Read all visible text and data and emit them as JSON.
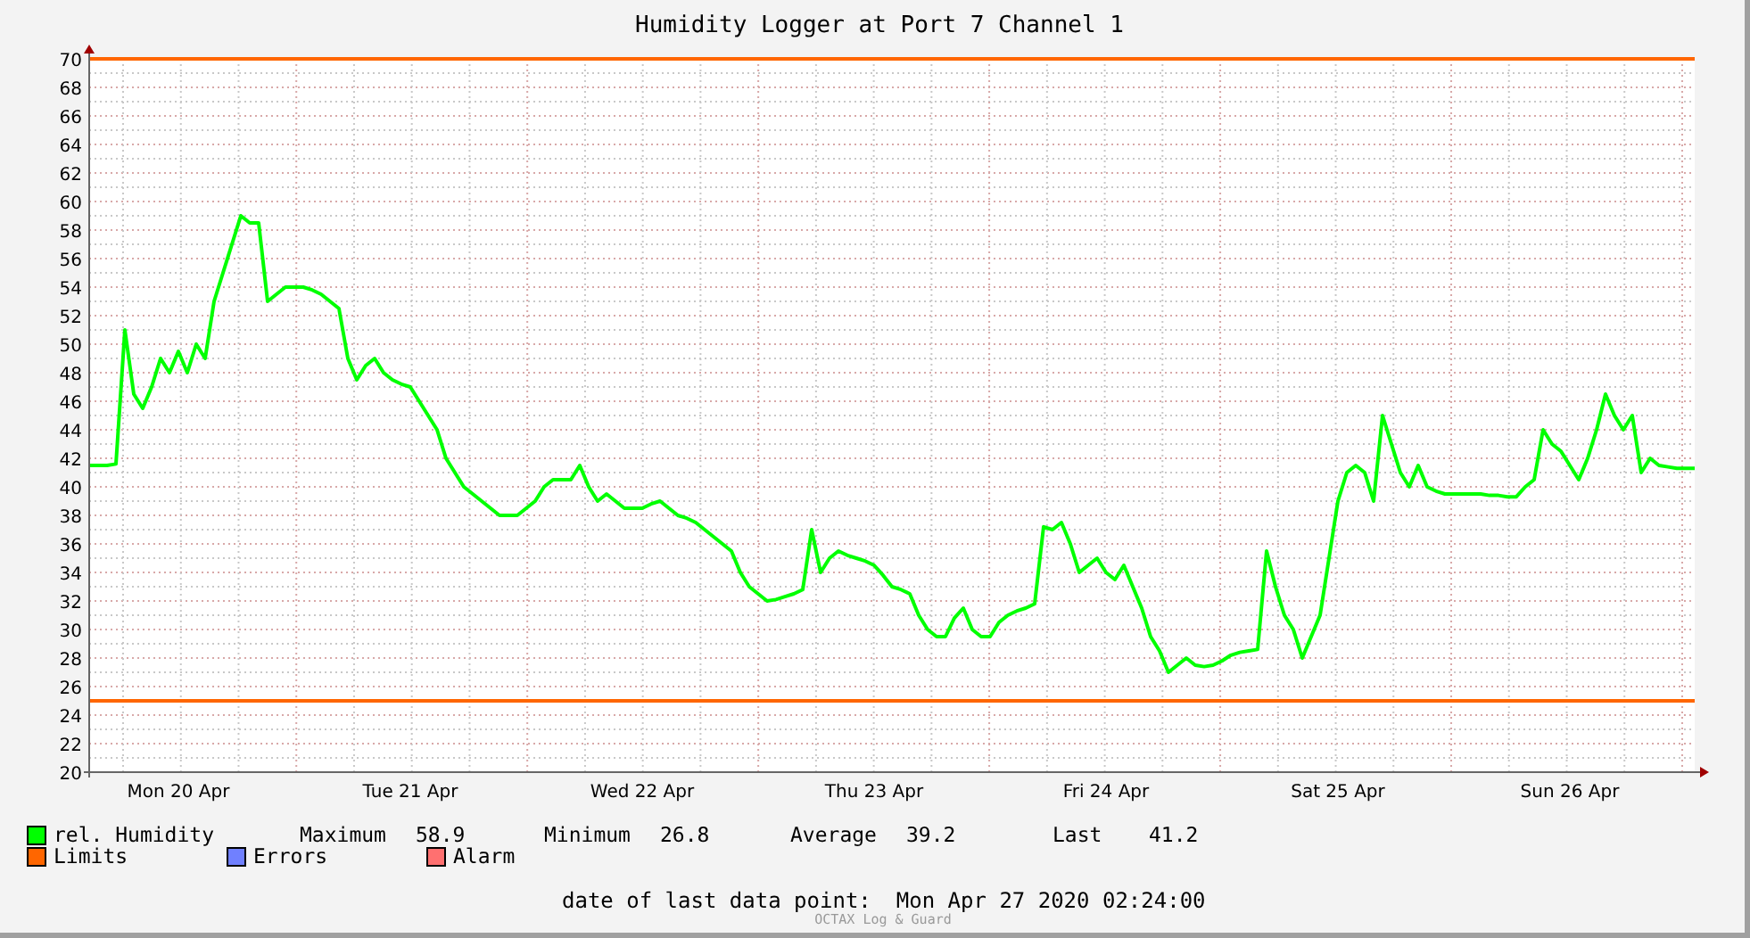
{
  "chart": {
    "title": "Humidity Logger at Port 7 Channel 1",
    "chart_data": {
      "type": "line",
      "ylim": [
        20,
        70
      ],
      "yticks": [
        20,
        22,
        24,
        26,
        28,
        30,
        32,
        34,
        36,
        38,
        40,
        42,
        44,
        46,
        48,
        50,
        52,
        54,
        56,
        58,
        60,
        62,
        64,
        66,
        68,
        70
      ],
      "categories": [
        null,
        null,
        null,
        null,
        null,
        null,
        null,
        null,
        null,
        null,
        "Mon 20 Apr",
        null,
        null,
        null,
        null,
        null,
        null,
        null,
        null,
        null,
        null,
        null,
        null,
        null,
        null,
        null,
        null,
        null,
        null,
        null,
        null,
        null,
        null,
        null,
        null,
        null,
        "Tue 21 Apr",
        null,
        null,
        null,
        null,
        null,
        null,
        null,
        null,
        null,
        null,
        null,
        null,
        null,
        null,
        null,
        null,
        null,
        null,
        null,
        null,
        null,
        null,
        null,
        null,
        null,
        "Wed 22 Apr",
        null,
        null,
        null,
        null,
        null,
        null,
        null,
        null,
        null,
        null,
        null,
        null,
        null,
        null,
        null,
        null,
        null,
        null,
        null,
        null,
        null,
        null,
        null,
        null,
        null,
        "Thu 23 Apr",
        null,
        null,
        null,
        null,
        null,
        null,
        null,
        null,
        null,
        null,
        null,
        null,
        null,
        null,
        null,
        null,
        null,
        null,
        null,
        null,
        null,
        null,
        null,
        null,
        null,
        "Fri 24 Apr",
        null,
        null,
        null,
        null,
        null,
        null,
        null,
        null,
        null,
        null,
        null,
        null,
        null,
        null,
        null,
        null,
        null,
        null,
        null,
        null,
        null,
        null,
        null,
        null,
        null,
        "Sat 25 Apr",
        null,
        null,
        null,
        null,
        null,
        null,
        null,
        null,
        null,
        null,
        null,
        null,
        null,
        null,
        null,
        null,
        null,
        null,
        null,
        null,
        null,
        null,
        null,
        null,
        null,
        "Sun 26 Apr",
        null,
        null,
        null,
        null,
        null,
        null,
        null,
        null,
        null,
        null,
        null,
        null,
        null,
        null
      ],
      "series": [
        {
          "name": "rel. Humidity",
          "color": "#00ff00",
          "values": [
            41.5,
            41.5,
            41.5,
            41.6,
            51,
            46.5,
            45.5,
            47,
            49,
            48,
            49.5,
            48,
            50,
            49,
            53,
            55,
            57,
            59,
            58.5,
            58.5,
            53,
            53.5,
            54,
            54,
            54,
            53.8,
            53.5,
            53,
            52.5,
            49,
            47.5,
            48.5,
            49,
            48,
            47.5,
            47.2,
            47,
            46,
            45,
            44,
            42,
            41,
            40,
            39.5,
            39,
            38.5,
            38,
            38,
            38,
            38.5,
            39,
            40,
            40.5,
            40.5,
            40.5,
            41.5,
            40,
            39,
            39.5,
            39,
            38.5,
            38.5,
            38.5,
            38.8,
            39,
            38.5,
            38,
            37.8,
            37.5,
            37,
            36.5,
            36,
            35.5,
            34,
            33,
            32.5,
            32,
            32.1,
            32.3,
            32.5,
            32.8,
            37,
            34,
            35,
            35.5,
            35.2,
            35,
            34.8,
            34.5,
            33.8,
            33,
            32.8,
            32.5,
            31,
            30,
            29.5,
            29.5,
            30.8,
            31.5,
            30,
            29.5,
            29.5,
            30.5,
            31,
            31.3,
            31.5,
            31.8,
            37.2,
            37,
            37.5,
            36,
            34,
            34.5,
            35,
            34,
            33.5,
            34.5,
            33,
            31.5,
            29.5,
            28.5,
            27,
            27.5,
            28,
            27.5,
            27.4,
            27.5,
            27.8,
            28.2,
            28.4,
            28.5,
            28.6,
            35.5,
            33,
            31,
            30,
            28,
            29.5,
            31,
            35,
            39,
            41,
            41.5,
            41,
            39,
            45,
            43,
            41,
            40,
            41.5,
            40,
            39.7,
            39.5,
            39.5,
            39.5,
            39.5,
            39.5,
            39.4,
            39.4,
            39.3,
            39.3,
            40,
            40.5,
            44,
            43,
            42.5,
            41.5,
            40.5,
            42,
            44,
            46.5,
            45,
            44,
            45,
            41,
            42,
            41.5,
            41.4,
            41.3,
            41.3,
            41.3
          ]
        }
      ],
      "grid": true,
      "ref_lines": [
        {
          "axis": "y",
          "value": 70
        },
        {
          "axis": "y",
          "value": 25
        }
      ]
    }
  },
  "legend": [
    {
      "label": "Limits",
      "color": "#ff6600"
    },
    {
      "label": "Errors",
      "color": "#7080ff"
    },
    {
      "label": "Alarm",
      "color": "#ff7070"
    }
  ],
  "stats": [
    {
      "label": "Maximum",
      "value": "58.9"
    },
    {
      "label": "Minimum",
      "value": "26.8"
    },
    {
      "label": "Average",
      "value": "39.2"
    },
    {
      "label": "Last",
      "value": "41.2"
    }
  ],
  "footer": {
    "label": "date of last data point:",
    "value": "Mon Apr 27 2020 02:24:00",
    "credit": "OCTAX Log & Guard"
  }
}
